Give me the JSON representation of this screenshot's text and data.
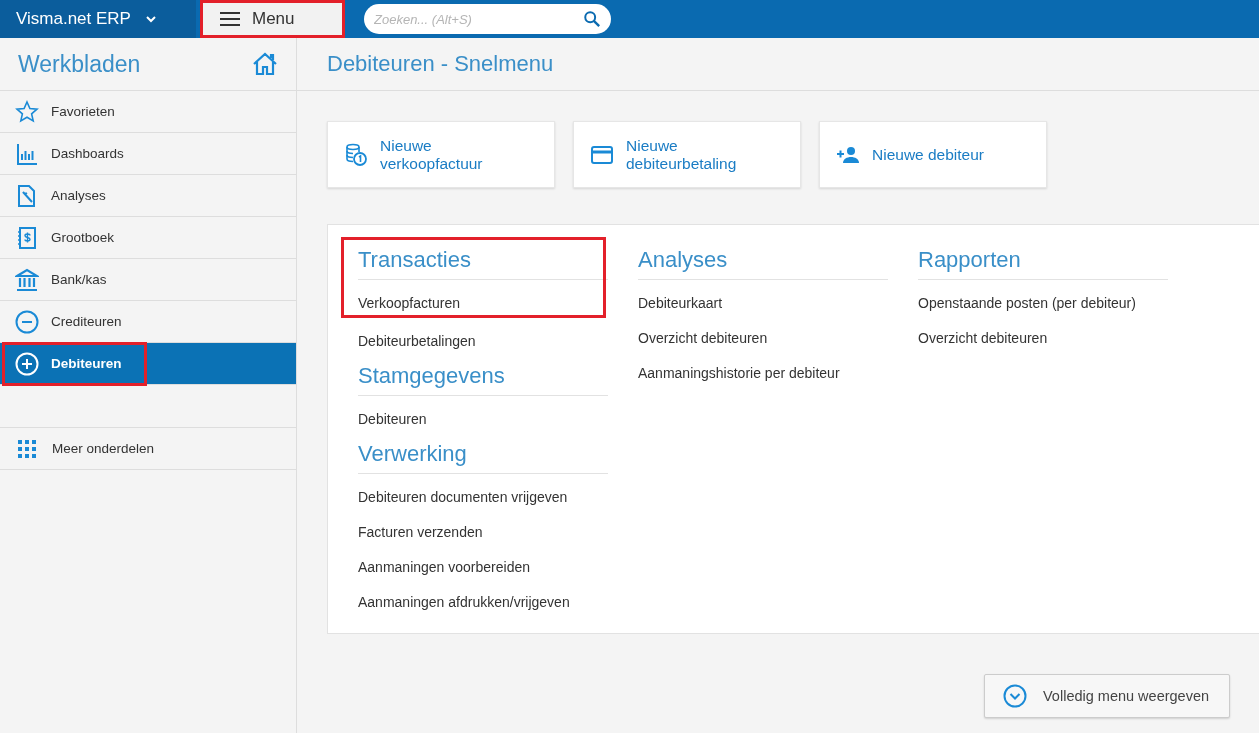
{
  "topbar": {
    "brand": "Visma.net ERP",
    "menu_button": {
      "label": "Menu",
      "highlighted": true
    },
    "search": {
      "placeholder": "Zoeken... (Alt+S)"
    }
  },
  "sidebar": {
    "title": "Werkbladen",
    "items": [
      {
        "label": "Favorieten",
        "kind": "star",
        "selected": false,
        "highlighted": false
      },
      {
        "label": "Dashboards",
        "kind": "chart",
        "selected": false,
        "highlighted": false
      },
      {
        "label": "Analyses",
        "kind": "doc",
        "selected": false,
        "highlighted": false
      },
      {
        "label": "Grootboek",
        "kind": "ledger",
        "selected": false,
        "highlighted": false
      },
      {
        "label": "Bank/kas",
        "kind": "bank",
        "selected": false,
        "highlighted": false
      },
      {
        "label": "Crediteuren",
        "kind": "minus",
        "selected": false,
        "highlighted": false
      },
      {
        "label": "Debiteuren",
        "kind": "plus",
        "selected": true,
        "highlighted": true
      }
    ],
    "more": {
      "label": "Meer onderdelen"
    }
  },
  "page_title": "Debiteuren - Snelmenu",
  "quick_actions": [
    {
      "label": "Nieuwe verkoopfactuur",
      "kind": "coins"
    },
    {
      "label": "Nieuwe debiteurbetaling",
      "kind": "card"
    },
    {
      "label": "Nieuwe debiteur",
      "kind": "adduser"
    }
  ],
  "columns": [
    [
      {
        "title": "Transacties",
        "highlighted": true,
        "links": [
          "Verkoopfacturen",
          "Debiteurbetalingen"
        ]
      },
      {
        "title": "Stamgegevens",
        "highlighted": false,
        "links": [
          "Debiteuren"
        ]
      },
      {
        "title": "Verwerking",
        "highlighted": false,
        "links": [
          "Debiteuren documenten vrijgeven",
          "Facturen verzenden",
          "Aanmaningen voorbereiden",
          "Aanmaningen afdrukken/vrijgeven"
        ]
      }
    ],
    [
      {
        "title": "Analyses",
        "highlighted": false,
        "links": [
          "Debiteurkaart",
          "Overzicht debiteuren",
          "Aanmaningshistorie per debiteur"
        ]
      }
    ],
    [
      {
        "title": "Rapporten",
        "highlighted": false,
        "links": [
          "Openstaande posten (per debiteur)",
          "Overzicht debiteuren"
        ]
      }
    ]
  ],
  "full_menu_button": {
    "label": "Volledig menu weergeven"
  }
}
